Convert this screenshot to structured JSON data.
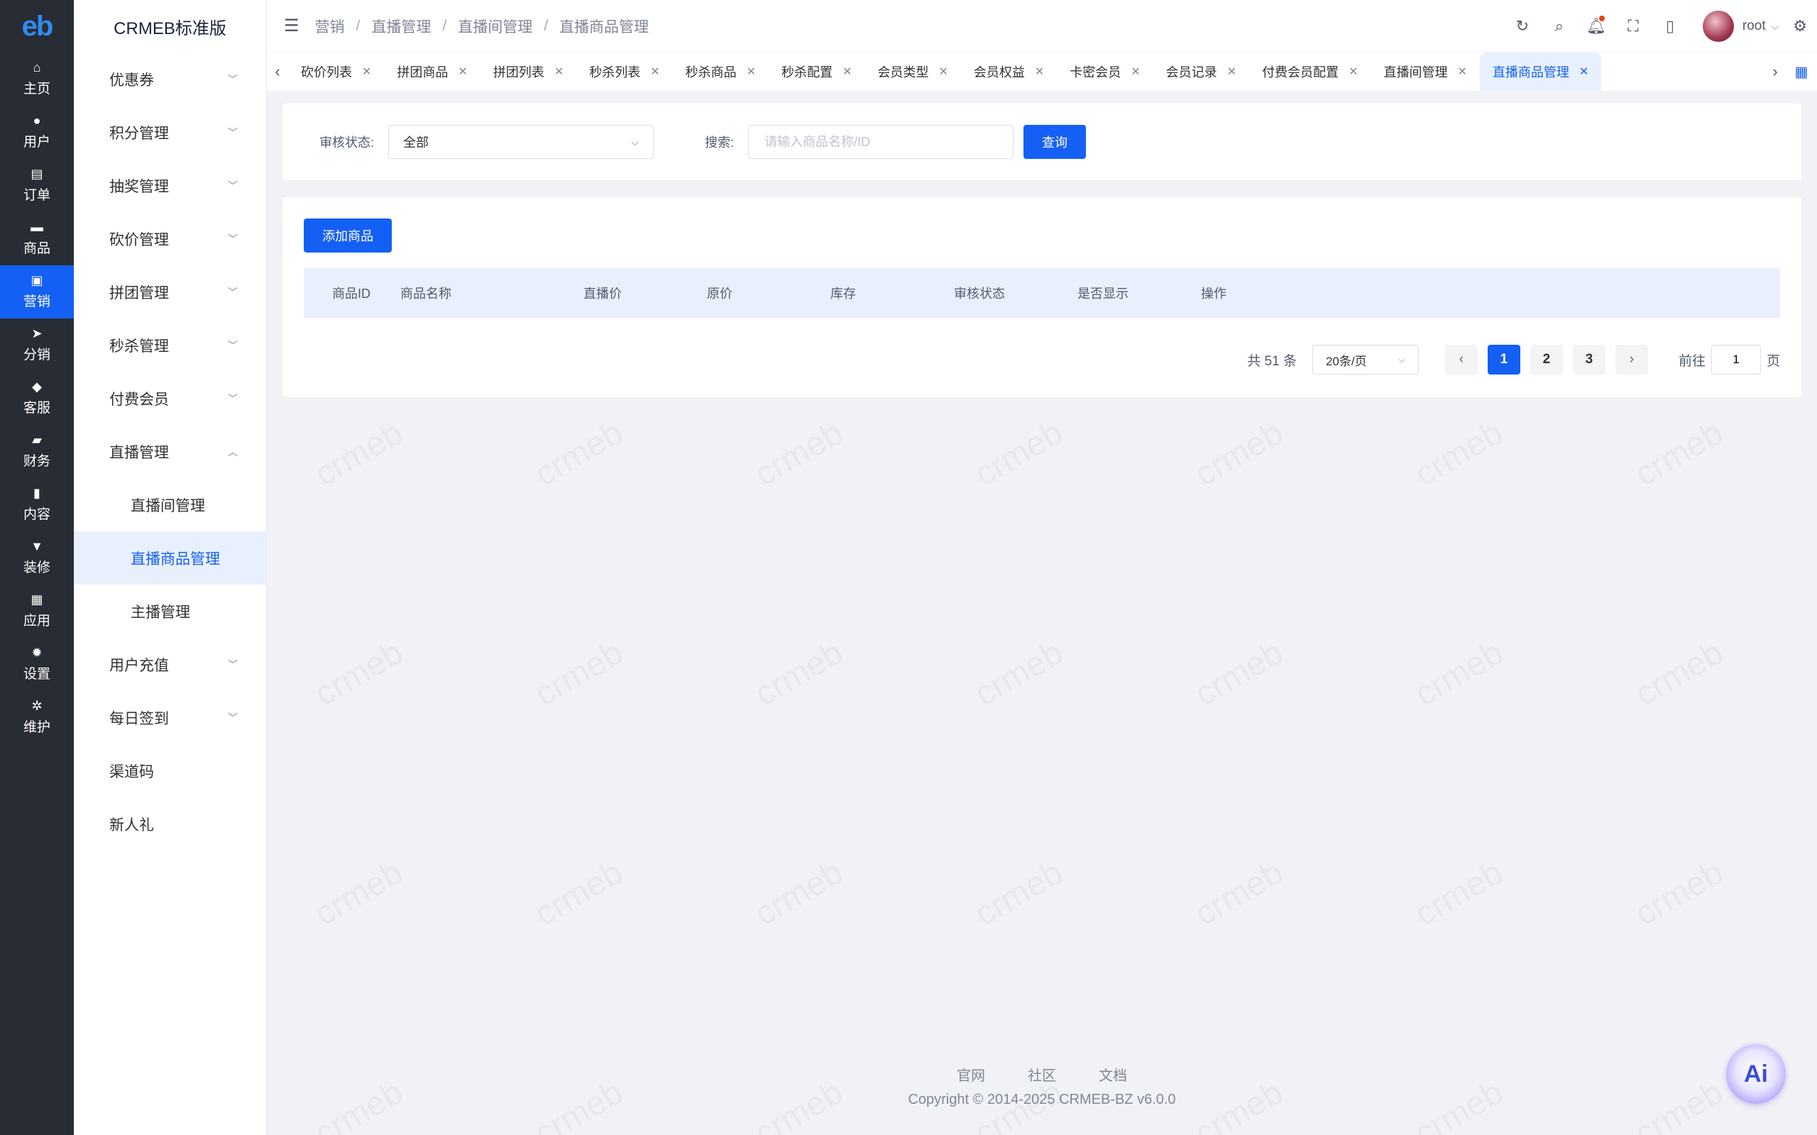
{
  "rail": {
    "logo": "eb",
    "items": [
      {
        "label": "主页",
        "icon": "home-icon",
        "glyph": "⌂"
      },
      {
        "label": "用户",
        "icon": "user-icon",
        "glyph": "●"
      },
      {
        "label": "订单",
        "icon": "order-icon",
        "glyph": "▤"
      },
      {
        "label": "商品",
        "icon": "goods-icon",
        "glyph": "▬"
      },
      {
        "label": "营销",
        "icon": "marketing-icon",
        "glyph": "▣"
      },
      {
        "label": "分销",
        "icon": "distribution-icon",
        "glyph": "➤"
      },
      {
        "label": "客服",
        "icon": "service-bell-icon",
        "glyph": "◆"
      },
      {
        "label": "财务",
        "icon": "finance-icon",
        "glyph": "▰"
      },
      {
        "label": "内容",
        "icon": "content-icon",
        "glyph": "▮"
      },
      {
        "label": "装修",
        "icon": "decorate-icon",
        "glyph": "▼"
      },
      {
        "label": "应用",
        "icon": "apps-icon",
        "glyph": "▦"
      },
      {
        "label": "设置",
        "icon": "settings-icon",
        "glyph": "✹"
      },
      {
        "label": "维护",
        "icon": "maintain-icon",
        "glyph": "✲"
      }
    ]
  },
  "submenu": {
    "brand": "CRMEB标准版",
    "items": [
      {
        "label": "优惠券"
      },
      {
        "label": "积分管理"
      },
      {
        "label": "抽奖管理"
      },
      {
        "label": "砍价管理"
      },
      {
        "label": "拼团管理"
      },
      {
        "label": "秒杀管理"
      },
      {
        "label": "付费会员"
      },
      {
        "label": "直播管理"
      }
    ],
    "live_children": [
      {
        "label": "直播间管理"
      },
      {
        "label": "直播商品管理"
      },
      {
        "label": "主播管理"
      }
    ],
    "after": [
      {
        "label": "用户充值"
      },
      {
        "label": "每日签到"
      },
      {
        "label": "渠道码"
      },
      {
        "label": "新人礼"
      }
    ]
  },
  "header": {
    "breadcrumb": [
      "营销",
      "直播管理",
      "直播间管理",
      "直播商品管理"
    ],
    "username": "root"
  },
  "tabs": [
    {
      "label": "砍价列表"
    },
    {
      "label": "拼团商品"
    },
    {
      "label": "拼团列表"
    },
    {
      "label": "秒杀列表"
    },
    {
      "label": "秒杀商品"
    },
    {
      "label": "秒杀配置"
    },
    {
      "label": "会员类型"
    },
    {
      "label": "会员权益"
    },
    {
      "label": "卡密会员"
    },
    {
      "label": "会员记录"
    },
    {
      "label": "付费会员配置"
    },
    {
      "label": "直播间管理"
    },
    {
      "label": "直播商品管理"
    }
  ],
  "filter": {
    "status_label": "审核状态:",
    "status_value": "全部",
    "search_label": "搜索:",
    "search_placeholder": "请输入商品名称/ID",
    "query_button": "查询"
  },
  "list": {
    "add_button": "添加商品",
    "columns": [
      "商品ID",
      "商品名称",
      "直播价",
      "原价",
      "库存",
      "审核状态",
      "是否显示",
      "操作"
    ]
  },
  "pagination": {
    "total": "共 51 条",
    "page_size": "20条/页",
    "pages": [
      "1",
      "2",
      "3"
    ],
    "goto_prefix": "前往",
    "goto_value": "1",
    "goto_suffix": "页"
  },
  "footer": {
    "links": [
      "官网",
      "社区",
      "文档"
    ],
    "copyright": "Copyright © 2014-2025 CRMEB-BZ v6.0.0"
  },
  "ai_label": "Ai",
  "colors": {
    "primary": "#1460f4",
    "rail_bg": "#282c34",
    "page_bg": "#f0f2f5"
  }
}
